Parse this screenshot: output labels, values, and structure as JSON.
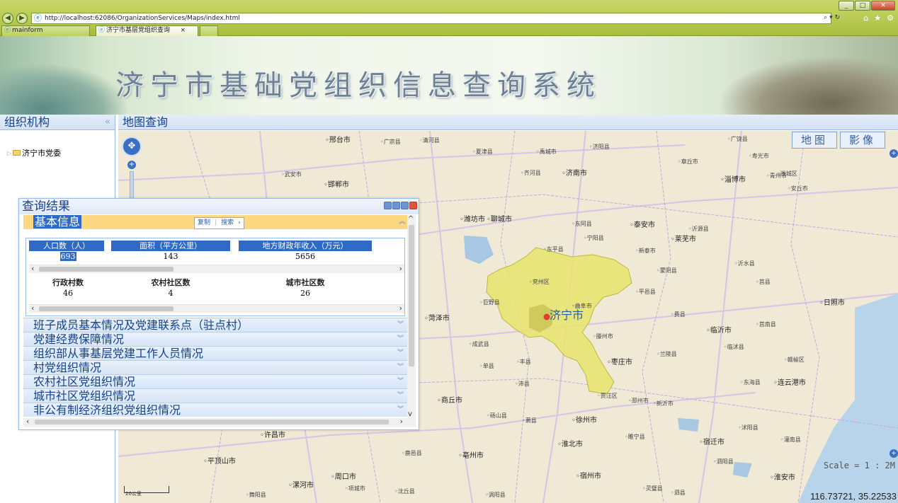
{
  "browser": {
    "url": "http://localhost:62086/OrganizationServices/Maps/index.html",
    "tabs": [
      {
        "label": "mainform"
      },
      {
        "label": "济宁市基层党组织查询"
      }
    ],
    "tab_close": "×"
  },
  "banner": {
    "title": "济宁市基础党组织信息查询系统"
  },
  "sidebar": {
    "title": "组织机构",
    "collapse_glyph": "«",
    "tree": [
      {
        "label": "济宁市党委"
      }
    ]
  },
  "map_panel": {
    "title": "地图查询",
    "map_type_buttons": [
      "地图",
      "影像"
    ],
    "scale": "Scale = 1 : 2M",
    "coordinates": "116.73721, 35.22533",
    "highlight_city": "济宁市",
    "cities": [
      {
        "name": "邢台市",
        "big": true
      },
      {
        "name": "广宗县"
      },
      {
        "name": "清河县"
      },
      {
        "name": "夏津县"
      },
      {
        "name": "禹城市"
      },
      {
        "name": "济阳县"
      },
      {
        "name": "广饶县"
      },
      {
        "name": "寿光市"
      },
      {
        "name": "武安市"
      },
      {
        "name": "邯郸市",
        "big": true
      },
      {
        "name": "齐河县"
      },
      {
        "name": "济南市",
        "big": true
      },
      {
        "name": "章丘市"
      },
      {
        "name": "淄博市",
        "big": true
      },
      {
        "name": "青州市"
      },
      {
        "name": "潍城区"
      },
      {
        "name": "潍坊市",
        "big": true
      },
      {
        "name": "聊城市",
        "big": true
      },
      {
        "name": "东阿县"
      },
      {
        "name": "泰安市",
        "big": true
      },
      {
        "name": "莱芜市",
        "big": true
      },
      {
        "name": "沂源县"
      },
      {
        "name": "安丘市"
      },
      {
        "name": "东平县"
      },
      {
        "name": "宁阳县"
      },
      {
        "name": "新泰市"
      },
      {
        "name": "蒙阴县"
      },
      {
        "name": "沂水县"
      },
      {
        "name": "莒县"
      },
      {
        "name": "日照市",
        "big": true
      },
      {
        "name": "菏泽市",
        "big": true
      },
      {
        "name": "巨野县"
      },
      {
        "name": "兖州区"
      },
      {
        "name": "曲阜市"
      },
      {
        "name": "平邑县"
      },
      {
        "name": "费县"
      },
      {
        "name": "临沂市",
        "big": true
      },
      {
        "name": "莒南县"
      },
      {
        "name": "成武县"
      },
      {
        "name": "单县"
      },
      {
        "name": "滕州市"
      },
      {
        "name": "枣庄市",
        "big": true
      },
      {
        "name": "兰陵县"
      },
      {
        "name": "临沭县"
      },
      {
        "name": "赣榆区"
      },
      {
        "name": "连云港市",
        "big": true
      },
      {
        "name": "丰县"
      },
      {
        "name": "沛县"
      },
      {
        "name": "贾汪区"
      },
      {
        "name": "邳州市"
      },
      {
        "name": "新沂市"
      },
      {
        "name": "东海县"
      },
      {
        "name": "商丘市",
        "big": true
      },
      {
        "name": "砀山县"
      },
      {
        "name": "萧县"
      },
      {
        "name": "徐州市",
        "big": true
      },
      {
        "name": "睢宁县"
      },
      {
        "name": "宿迁市",
        "big": true
      },
      {
        "name": "沭阳县"
      },
      {
        "name": "灌南县"
      },
      {
        "name": "许昌市",
        "big": true
      },
      {
        "name": "平顶山市",
        "big": true
      },
      {
        "name": "鹿邑县"
      },
      {
        "name": "亳州市",
        "big": true
      },
      {
        "name": "淮北市",
        "big": true
      },
      {
        "name": "周口市",
        "big": true
      },
      {
        "name": "漯河市",
        "big": true
      },
      {
        "name": "宿州市",
        "big": true
      },
      {
        "name": "泗阳县"
      },
      {
        "name": "淮安市",
        "big": true
      },
      {
        "name": "涡阳县"
      },
      {
        "name": "灵璧县"
      },
      {
        "name": "泗县"
      },
      {
        "name": "舞阳县"
      },
      {
        "name": "项城市"
      },
      {
        "name": "沈丘县"
      }
    ],
    "scalebar_label": "20公里"
  },
  "dialog": {
    "title": "查询结果",
    "section_title": "基本信息",
    "popup": {
      "copy": "复制",
      "search": "搜索"
    },
    "table1": {
      "headers": [
        "人口数（人）",
        "面积（平方公里）",
        "地方财政年收入（万元）"
      ],
      "values": [
        "693",
        "143",
        "5656"
      ]
    },
    "table2": {
      "headers": [
        "行政村数",
        "农村社区数",
        "城市社区数"
      ],
      "values": [
        "46",
        "4",
        "26"
      ]
    },
    "sections": [
      "班子成员基本情况及党建联系点（驻点村）",
      "党建经费保障情况",
      "组织部从事基层党建工作人员情况",
      "村党组织情况",
      "农村社区党组织情况",
      "城市社区党组织情况",
      "非公有制经济组织党组织情况"
    ]
  }
}
